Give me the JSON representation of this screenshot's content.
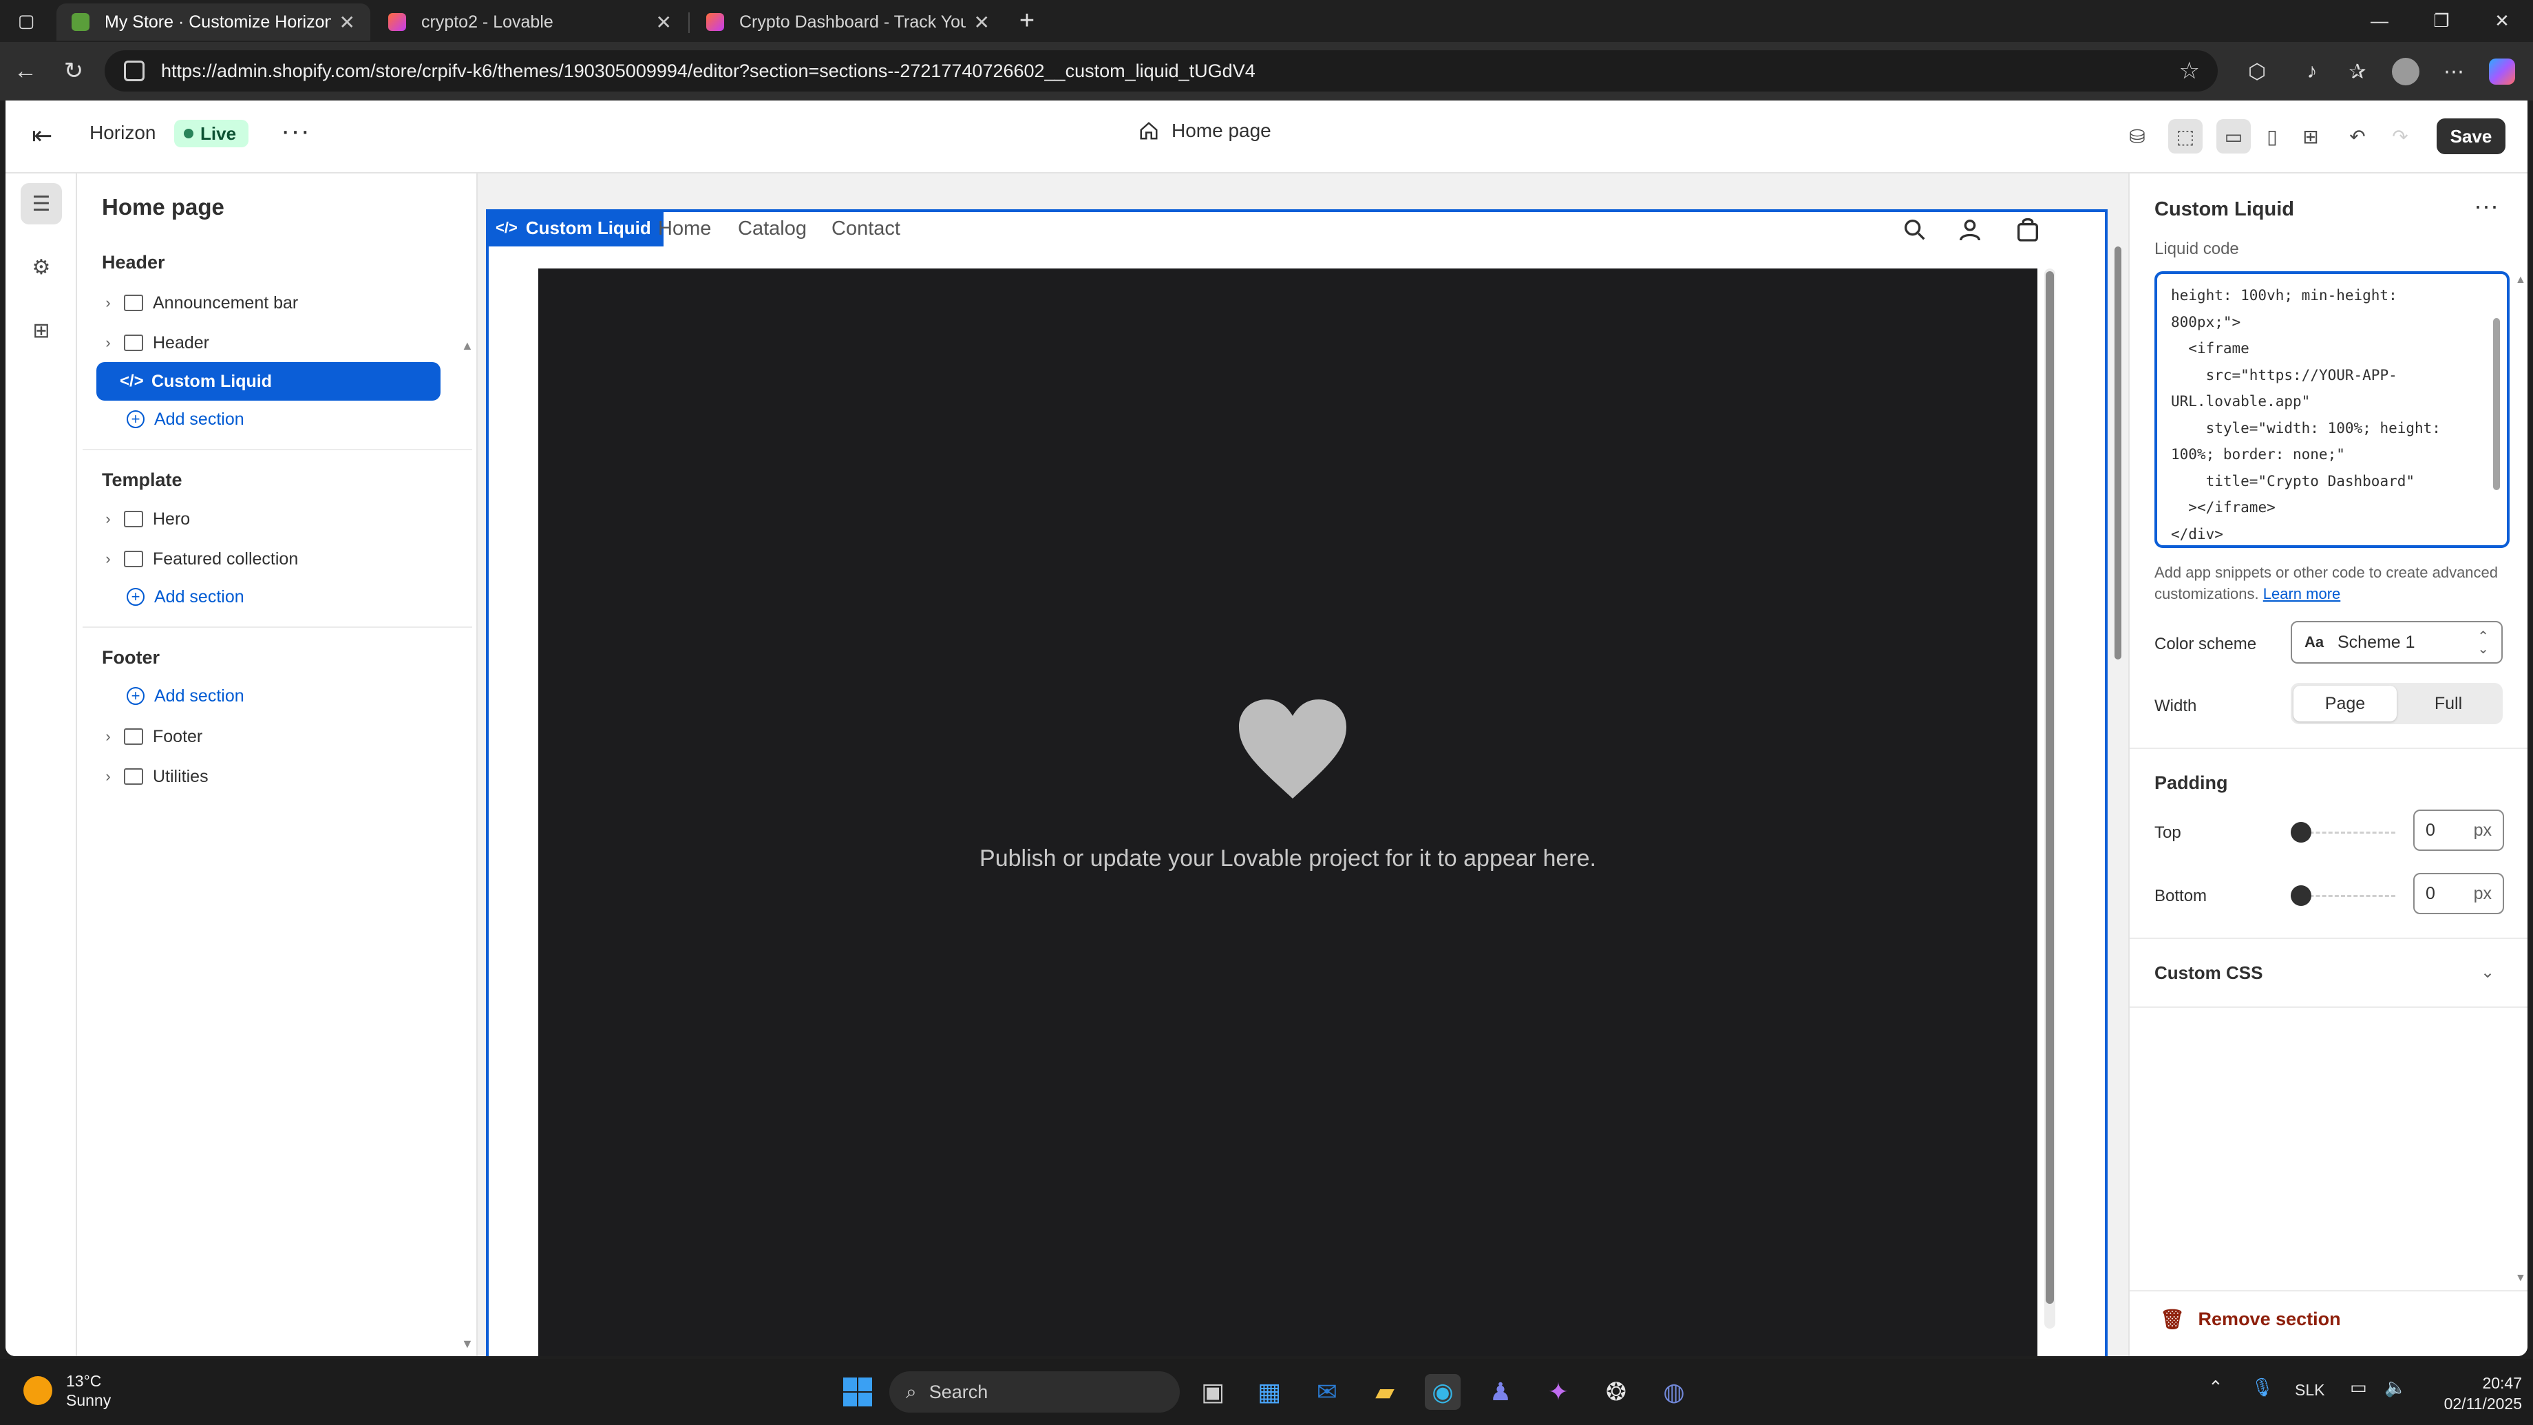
{
  "browser": {
    "tabs": [
      {
        "title": "My Store · Customize Horizon · Sh",
        "active": true,
        "favicon_color": "#5a9e3a"
      },
      {
        "title": "crypto2 - Lovable",
        "active": false,
        "favicon_color": "#e8553d"
      },
      {
        "title": "Crypto Dashboard - Track Your Po",
        "active": false,
        "favicon_color": "#e8553d"
      }
    ],
    "new_tab": "+",
    "url": "https://admin.shopify.com/store/crpifv-k6/themes/190305009994/editor?section=sections--27217740726602__custom_liquid_tUGdV4"
  },
  "topbar": {
    "theme_name": "Horizon",
    "status": "Live",
    "page": "Home page",
    "save_label": "Save"
  },
  "sidebar": {
    "title": "Home page",
    "groups": {
      "header": {
        "label": "Header",
        "items": [
          "Announcement bar",
          "Header",
          "Custom Liquid"
        ],
        "add": "Add section"
      },
      "template": {
        "label": "Template",
        "items": [
          "Hero",
          "Featured collection"
        ],
        "add": "Add section"
      },
      "footer": {
        "label": "Footer",
        "add": "Add section",
        "items": [
          "Footer",
          "Utilities"
        ]
      }
    }
  },
  "preview": {
    "tag": "Custom Liquid",
    "nav": [
      "Home",
      "Catalog",
      "Contact"
    ],
    "message": "Publish or update your Lovable project for it to appear here."
  },
  "panel": {
    "title": "Custom Liquid",
    "code_label": "Liquid code",
    "code": "height: 100vh; min-height:\n800px;\">\n  <iframe\n    src=\"https://YOUR-APP-\nURL.lovable.app\"\n    style=\"width: 100%; height:\n100%; border: none;\"\n    title=\"Crypto Dashboard\"\n  ></iframe>\n</div>",
    "hint": "Add app snippets or other code to create advanced customizations.",
    "learn_more": "Learn more",
    "color_scheme_label": "Color scheme",
    "color_scheme_value": "Scheme 1",
    "width_label": "Width",
    "width_options": [
      "Page",
      "Full"
    ],
    "width_selected": "Page",
    "padding_label": "Padding",
    "top_label": "Top",
    "top_value": "0",
    "bottom_label": "Bottom",
    "bottom_value": "0",
    "unit": "px",
    "custom_css": "Custom CSS",
    "remove": "Remove section"
  },
  "taskbar": {
    "temp": "13°C",
    "weather": "Sunny",
    "search": "Search",
    "lang": "SLK",
    "time": "20:47",
    "date": "02/11/2025"
  },
  "colors": {
    "accent": "#0b5ed7",
    "live_badge": "#cdfee1",
    "danger": "#8e1f0b"
  }
}
